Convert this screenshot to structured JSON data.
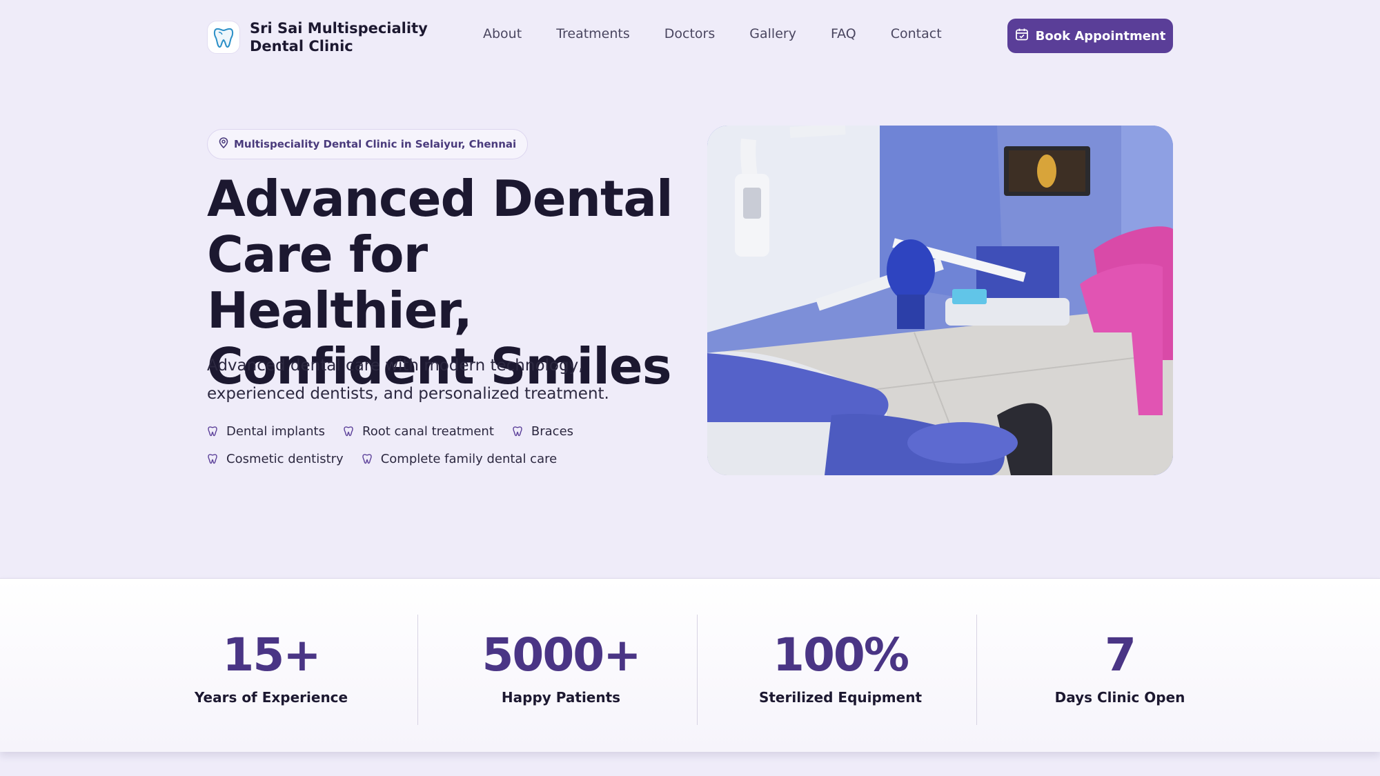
{
  "header": {
    "brand_name": "Sri Sai Multispeciality Dental Clinic",
    "brand_icon": "tooth-logo-icon",
    "nav": [
      "About",
      "Treatments",
      "Doctors",
      "Gallery",
      "FAQ",
      "Contact"
    ],
    "cta_label": "Book Appointment",
    "cta_icon": "calendar-icon"
  },
  "hero": {
    "badge": "Multispeciality Dental Clinic in Selaiyur, Chennai",
    "badge_icon": "location-pin-icon",
    "title": "Advanced Dental Care for Healthier, Confident Smiles",
    "subtitle": "Advanced dental care with modern technology, experienced dentists, and personalized treatment.",
    "features": [
      "Dental implants",
      "Root canal treatment",
      "Braces",
      "Cosmetic dentistry",
      "Complete family dental care"
    ],
    "feature_icon": "tooth-icon"
  },
  "stats": [
    {
      "value": "15+",
      "label": "Years of Experience"
    },
    {
      "value": "5000+",
      "label": "Happy Patients"
    },
    {
      "value": "100%",
      "label": "Sterilized Equipment"
    },
    {
      "value": "7",
      "label": "Days Clinic Open"
    }
  ],
  "colors": {
    "accent": "#5a3e98",
    "page_bg": "#efecf9",
    "stat_value": "#4a3585",
    "heading": "#1c1830"
  }
}
